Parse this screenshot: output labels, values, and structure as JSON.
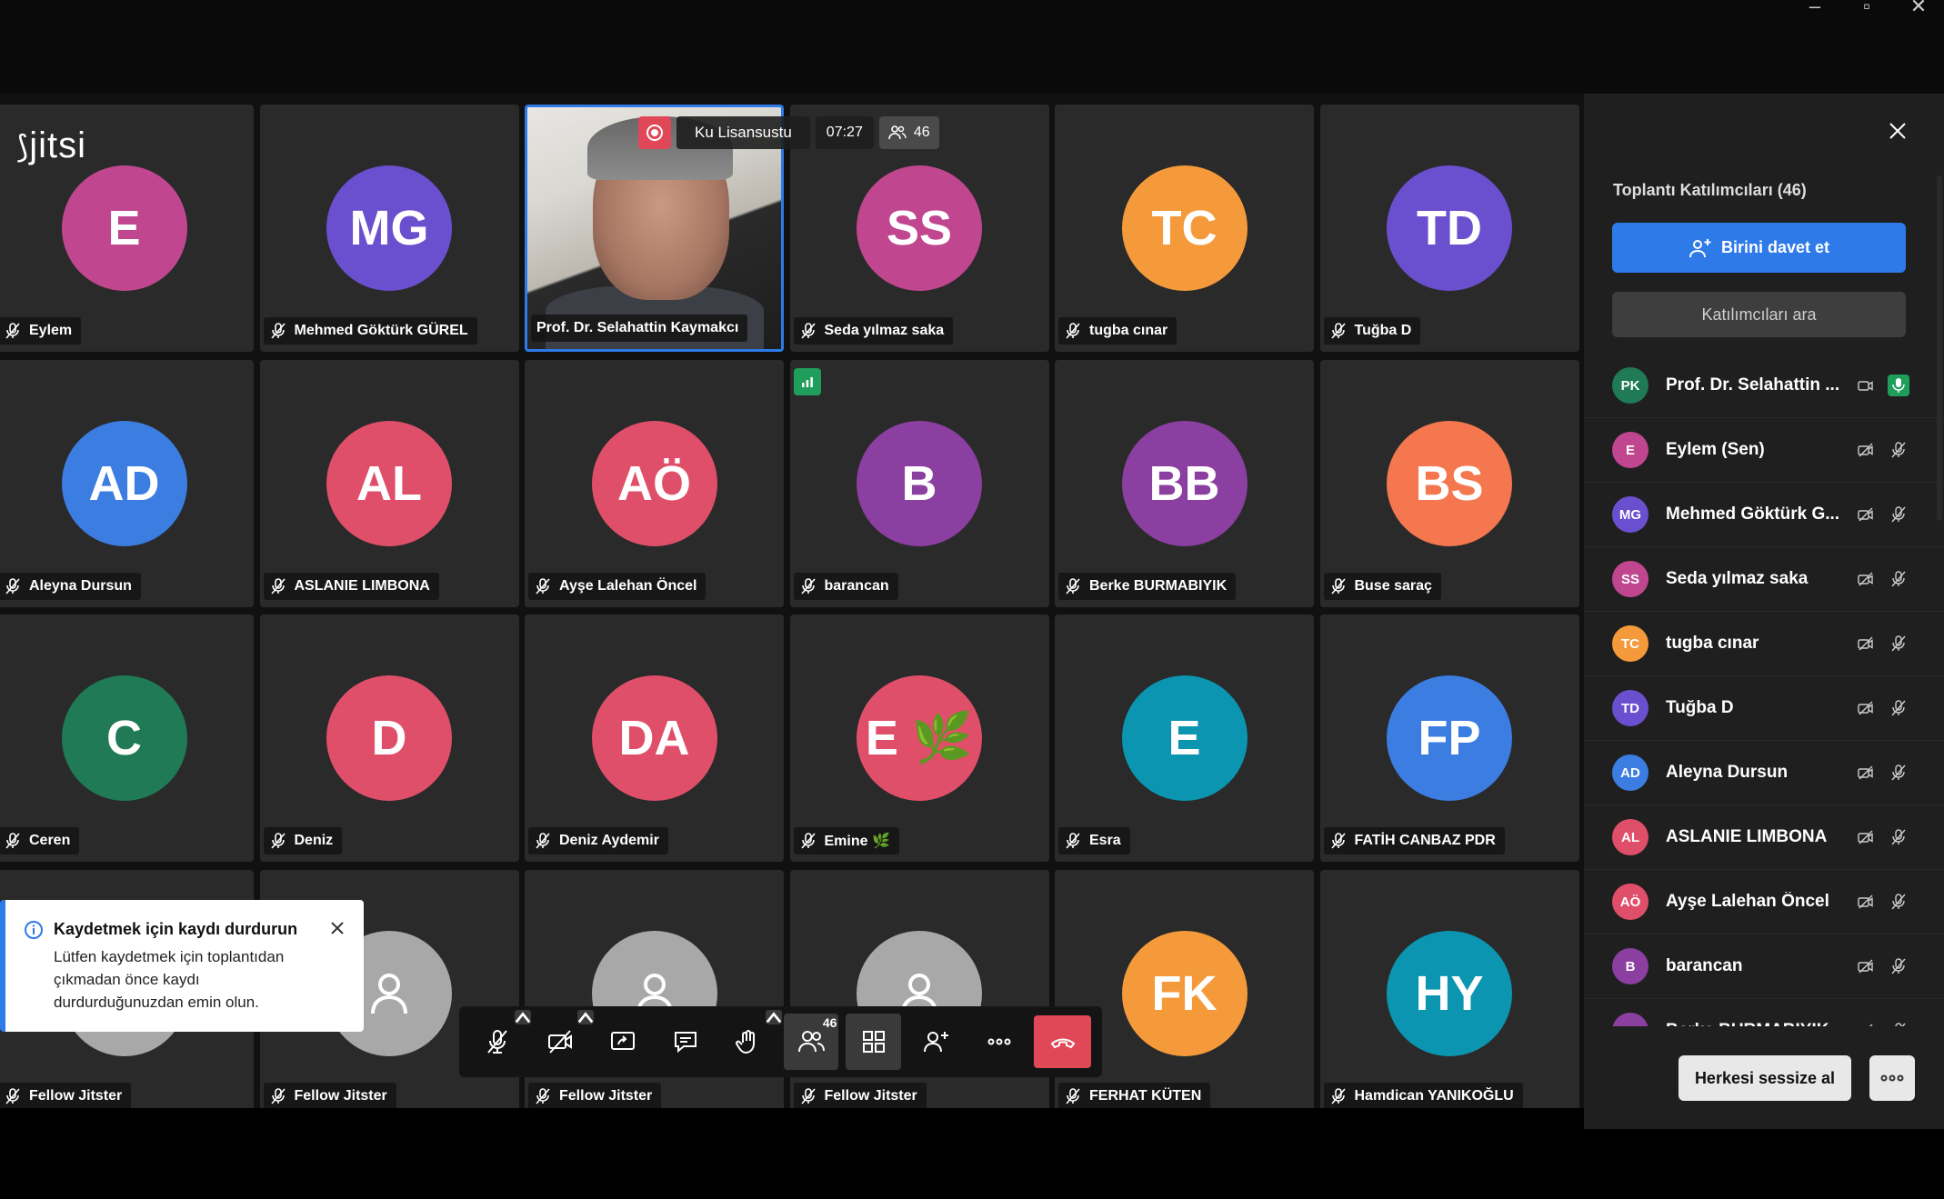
{
  "window": {
    "minimize_icon": "minimize-icon",
    "maximize_icon": "maximize-icon",
    "close_icon": "close-icon"
  },
  "app": {
    "logo": "jitsi"
  },
  "recording": {
    "title": "Ku Lisansustu",
    "time": "07:27",
    "participant_count": "46"
  },
  "tiles": [
    {
      "initials": "E",
      "name": "Eylem",
      "color": "#c0478f"
    },
    {
      "initials": "MG",
      "name": "Mehmed Göktürk GÜREL",
      "color": "#6a4fcf"
    },
    {
      "initials": "",
      "name": "Prof. Dr. Selahattin Kaymakcı",
      "color": "",
      "video": true
    },
    {
      "initials": "SS",
      "name": "Seda yılmaz saka",
      "color": "#c0478f"
    },
    {
      "initials": "TC",
      "name": "tugba cınar",
      "color": "#f59a3b"
    },
    {
      "initials": "TD",
      "name": "Tuğba D",
      "color": "#6a4fcf"
    },
    {
      "initials": "AD",
      "name": "Aleyna Dursun",
      "color": "#3b7de0"
    },
    {
      "initials": "AL",
      "name": "ASLANIE LIMBONA",
      "color": "#e04f6a"
    },
    {
      "initials": "AÖ",
      "name": "Ayşe Lalehan Öncel",
      "color": "#e04f6a"
    },
    {
      "initials": "B",
      "name": "barancan",
      "color": "#8b3fa0"
    },
    {
      "initials": "BB",
      "name": "Berke BURMABIYIK",
      "color": "#8b3fa0"
    },
    {
      "initials": "BS",
      "name": "Buse saraç",
      "color": "#f5774f"
    },
    {
      "initials": "C",
      "name": "Ceren",
      "color": "#1f7a55"
    },
    {
      "initials": "D",
      "name": "Deniz",
      "color": "#e04f6a"
    },
    {
      "initials": "DA",
      "name": "Deniz Aydemir",
      "color": "#e04f6a"
    },
    {
      "initials": "E 🌿",
      "name": "Emine 🌿",
      "color": "#e04f6a"
    },
    {
      "initials": "E",
      "name": "Esra",
      "color": "#0b95b0"
    },
    {
      "initials": "FP",
      "name": "FATİH CANBAZ PDR",
      "color": "#3b7de0"
    },
    {
      "initials": "",
      "name": "Fellow Jitster",
      "color": "",
      "generic": true
    },
    {
      "initials": "",
      "name": "Fellow Jitster",
      "color": "",
      "generic": true
    },
    {
      "initials": "",
      "name": "Fellow Jitster",
      "color": "",
      "generic": true
    },
    {
      "initials": "",
      "name": "Fellow Jitster",
      "color": "",
      "generic": true
    },
    {
      "initials": "FK",
      "name": "FERHAT KÜTEN",
      "color": "#f59a3b"
    },
    {
      "initials": "HY",
      "name": "Hamdican YANIKOĞLU",
      "color": "#0b95b0"
    }
  ],
  "notice": {
    "title": "Kaydetmek için kaydı durdurun",
    "body": "Lütfen kaydetmek için toplantıdan çıkmadan önce kaydı durdurduğunuzdan emin olun."
  },
  "toolbar": {
    "participants_badge": "46"
  },
  "panel": {
    "title": "Toplantı Katılımcıları (46)",
    "invite_label": "Birini davet et",
    "search_placeholder": "Katılımcıları ara",
    "mute_all_label": "Herkesi sessize al",
    "participants": [
      {
        "initials": "PK",
        "name": "Prof. Dr. Selahattin ...",
        "color": "#1f7a55",
        "mic_on": true,
        "video_on": true
      },
      {
        "initials": "E",
        "name": "Eylem (Sen)",
        "color": "#c0478f"
      },
      {
        "initials": "MG",
        "name": "Mehmed Göktürk G...",
        "color": "#6a4fcf"
      },
      {
        "initials": "SS",
        "name": "Seda yılmaz saka",
        "color": "#c0478f"
      },
      {
        "initials": "TC",
        "name": "tugba cınar",
        "color": "#f59a3b"
      },
      {
        "initials": "TD",
        "name": "Tuğba D",
        "color": "#6a4fcf"
      },
      {
        "initials": "AD",
        "name": "Aleyna Dursun",
        "color": "#3b7de0"
      },
      {
        "initials": "AL",
        "name": "ASLANIE LIMBONA",
        "color": "#e04f6a"
      },
      {
        "initials": "AÖ",
        "name": "Ayşe Lalehan Öncel",
        "color": "#e04f6a"
      },
      {
        "initials": "B",
        "name": "barancan",
        "color": "#8b3fa0"
      },
      {
        "initials": "BB",
        "name": "Berke BURMABIYIK",
        "color": "#8b3fa0"
      }
    ]
  }
}
